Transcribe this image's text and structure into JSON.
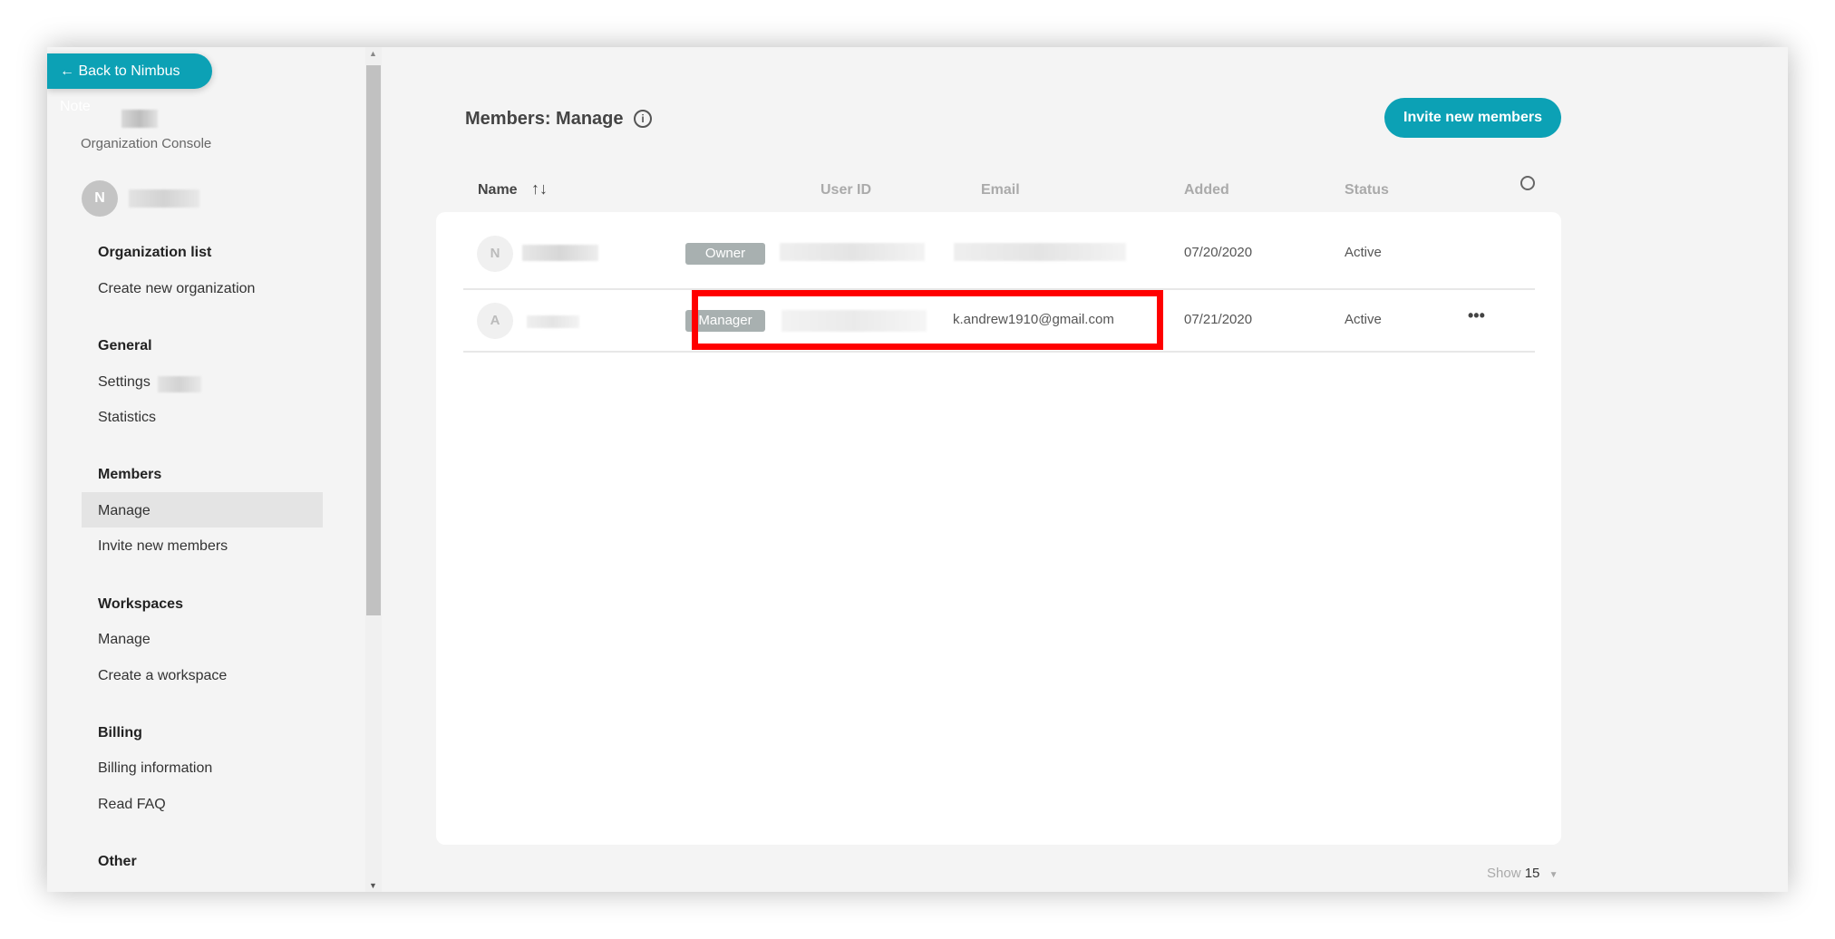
{
  "sidebar": {
    "back_label": "← Back to Nimbus Note",
    "console_label": "Organization Console",
    "user_avatar_initial": "N",
    "sections": [
      {
        "heading": "Organization list",
        "items": [
          "Create new organization"
        ]
      },
      {
        "heading": "General",
        "items": [
          "Settings",
          "Statistics"
        ]
      },
      {
        "heading": "Members",
        "items": [
          "Manage",
          "Invite new members"
        ]
      },
      {
        "heading": "Workspaces",
        "items": [
          "Manage",
          "Create a workspace"
        ]
      },
      {
        "heading": "Billing",
        "items": [
          "Billing information",
          "Read FAQ"
        ]
      },
      {
        "heading": "Other",
        "items": []
      }
    ],
    "active_item": "Members / Manage"
  },
  "main": {
    "title": "Members: Manage",
    "info_icon": "i",
    "invite_label": "Invite new members",
    "columns": [
      "Name",
      "User ID",
      "Email",
      "Added",
      "Status"
    ],
    "sort_icons": "↑↓",
    "rows": [
      {
        "initial": "N",
        "role": "Owner",
        "email": "",
        "added": "07/20/2020",
        "status": "Active"
      },
      {
        "initial": "A",
        "role": "Manager",
        "email": "k.andrew1910@gmail.com",
        "added": "07/21/2020",
        "status": "Active",
        "menu": "•••"
      }
    ],
    "show_label": "Show",
    "show_value": "15"
  },
  "colors": {
    "accent": "#0ca1b5",
    "highlight": "#ff0000"
  }
}
